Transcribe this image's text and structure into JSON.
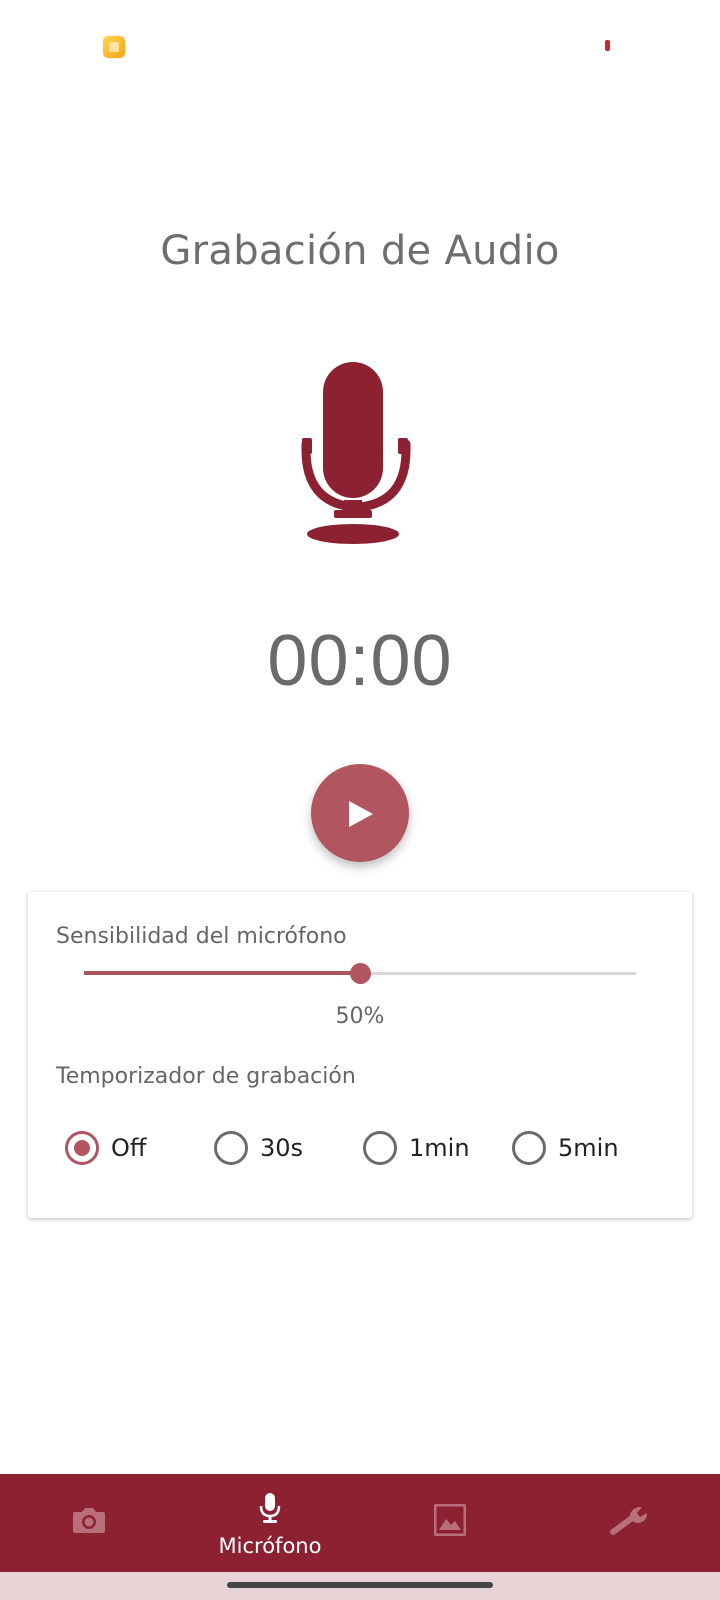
{
  "screen": {
    "title": "Grabación de Audio",
    "timer": "00:00"
  },
  "icons": {
    "app_notification": "app-notification-icon",
    "recording_indicator": "recording-indicator-icon",
    "microphone_large": "microphone-icon",
    "play": "play-icon"
  },
  "settings": {
    "sensitivity_label": "Sensibilidad del micrófono",
    "sensitivity_value": 50,
    "sensitivity_text": "50%",
    "timer_label": "Temporizador de grabación",
    "timer_options": [
      {
        "label": "Off",
        "selected": true
      },
      {
        "label": "30s",
        "selected": false
      },
      {
        "label": "1min",
        "selected": false
      },
      {
        "label": "5min",
        "selected": false
      }
    ]
  },
  "nav": {
    "items": [
      {
        "icon": "camera-icon",
        "label": "",
        "active": false
      },
      {
        "icon": "microphone-icon",
        "label": "Micrófono",
        "active": true
      },
      {
        "icon": "gallery-icon",
        "label": "",
        "active": false
      },
      {
        "icon": "wrench-icon",
        "label": "",
        "active": false
      }
    ]
  },
  "colors": {
    "accent": "#b15561",
    "mic_dark": "#8b2131",
    "nav_background": "#8b2131"
  }
}
